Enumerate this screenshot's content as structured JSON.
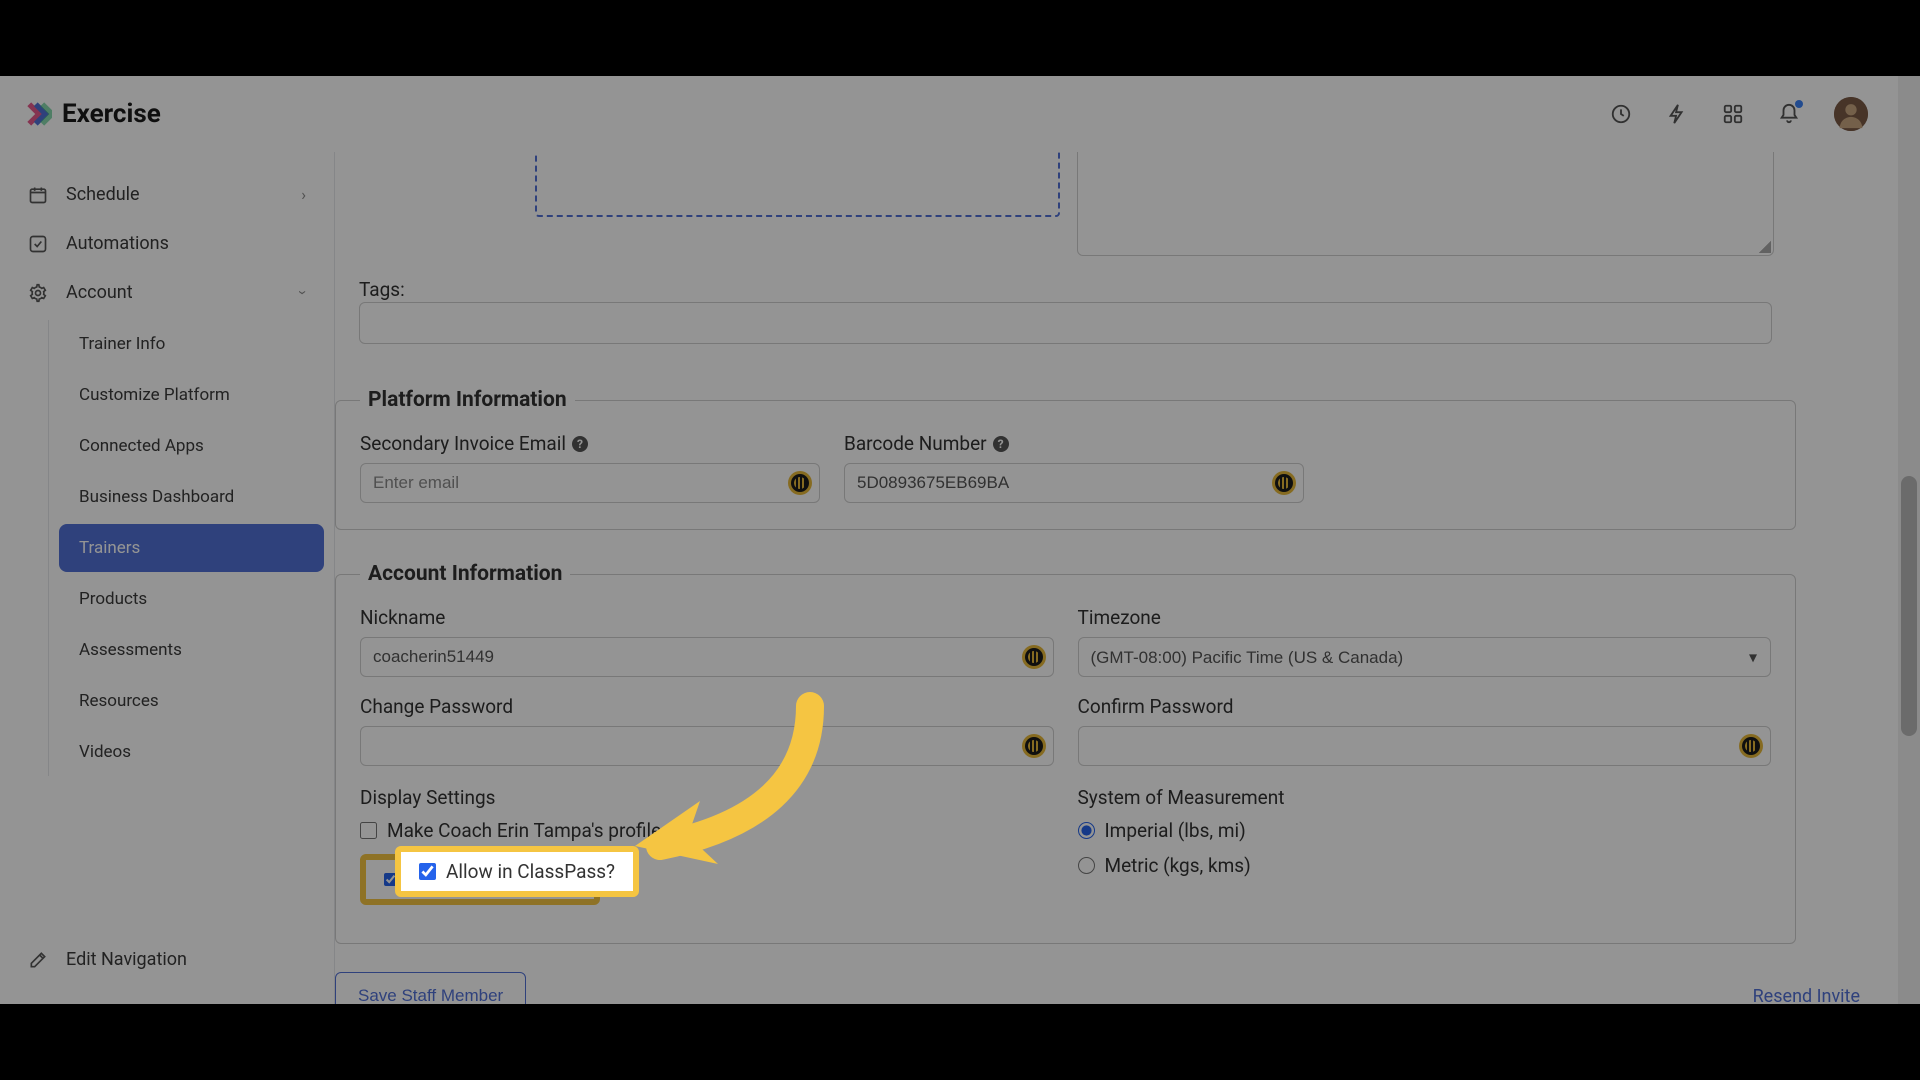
{
  "brand": {
    "name": "Exercise"
  },
  "nav": {
    "schedule": "Schedule",
    "automations": "Automations",
    "account": "Account",
    "edit_navigation": "Edit Navigation",
    "sub": {
      "trainer_info": "Trainer Info",
      "customize_platform": "Customize Platform",
      "connected_apps": "Connected Apps",
      "business_dashboard": "Business Dashboard",
      "trainers": "Trainers",
      "products": "Products",
      "assessments": "Assessments",
      "resources": "Resources",
      "videos": "Videos"
    }
  },
  "tags": {
    "label": "Tags:"
  },
  "platform": {
    "legend": "Platform Information",
    "secondary_email_label": "Secondary Invoice Email",
    "secondary_email_placeholder": "Enter email",
    "barcode_label": "Barcode Number",
    "barcode_value": "5D0893675EB69BA"
  },
  "account": {
    "legend": "Account Information",
    "nickname_label": "Nickname",
    "nickname_value": "coacherin51449",
    "timezone_label": "Timezone",
    "timezone_value": "(GMT-08:00) Pacific Time (US & Canada)",
    "change_password_label": "Change Password",
    "confirm_password_label": "Confirm Password",
    "display_settings_label": "Display Settings",
    "profile_public_label": "Make Coach Erin Tampa's profile public",
    "allow_classpass_label": "Allow in ClassPass?",
    "som_label": "System of Measurement",
    "imperial_label": "Imperial (lbs, mi)",
    "metric_label": "Metric (kgs, kms)"
  },
  "actions": {
    "save": "Save Staff Member",
    "resend": "Resend Invite"
  }
}
